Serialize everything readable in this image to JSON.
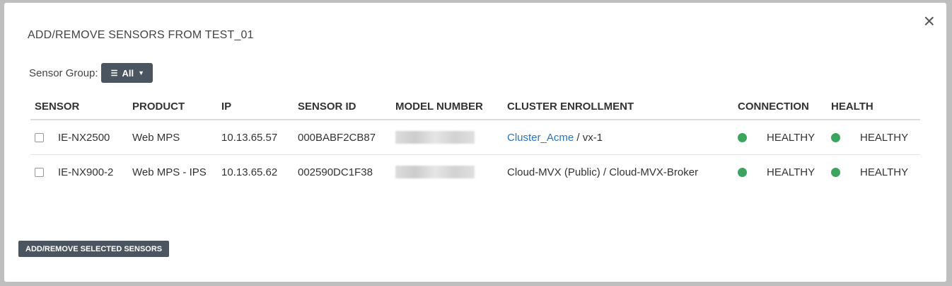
{
  "modal": {
    "title": "ADD/REMOVE SENSORS FROM TEST_01",
    "close_label": "×"
  },
  "filter": {
    "label": "Sensor Group:",
    "value": "All"
  },
  "table": {
    "headers": [
      "SENSOR",
      "PRODUCT",
      "IP",
      "SENSOR ID",
      "MODEL NUMBER",
      "CLUSTER ENROLLMENT",
      "CONNECTION",
      "HEALTH"
    ],
    "rows": [
      {
        "sensor": "IE-NX2500",
        "product": "Web MPS",
        "ip": "10.13.65.57",
        "sensor_id": "000BABF2CB87",
        "cluster_link": "Cluster_Acme",
        "cluster_rest": " / vx-1",
        "connection": "HEALTHY",
        "health": "HEALTHY"
      },
      {
        "sensor": "IE-NX900-2",
        "product": "Web MPS - IPS",
        "ip": "10.13.65.62",
        "sensor_id": "002590DC1F38",
        "cluster_link": "",
        "cluster_rest": "Cloud-MVX (Public) / Cloud-MVX-Broker",
        "connection": "HEALTHY",
        "health": "HEALTHY"
      }
    ]
  },
  "actions": {
    "submit_label": "ADD/REMOVE SELECTED SENSORS"
  },
  "colors": {
    "status_ok": "#3aa55f",
    "button_bg": "#4a5560",
    "link": "#2a74b8"
  }
}
